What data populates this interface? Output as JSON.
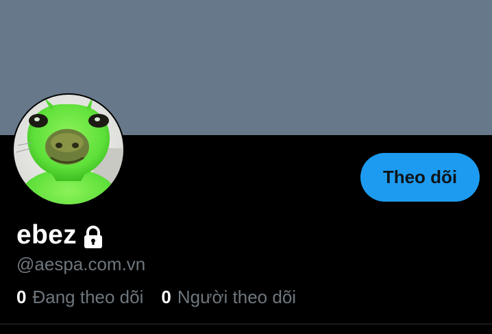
{
  "colors": {
    "banner": "#66788a",
    "background": "#000000",
    "accent": "#1d9bf0",
    "button_text": "#0f1419",
    "primary_text": "#ffffff",
    "secondary_text": "#6e767d",
    "divider": "#2f3336"
  },
  "profile": {
    "display_name": "ebez",
    "locked_icon": "lock-icon",
    "handle": "@aespa.com.vn",
    "avatar_icon": "green-frog-avatar"
  },
  "actions": {
    "follow_label": "Theo dõi"
  },
  "stats": [
    {
      "count": "0",
      "label": "Đang theo dõi"
    },
    {
      "count": "0",
      "label": "Người theo dõi"
    }
  ]
}
